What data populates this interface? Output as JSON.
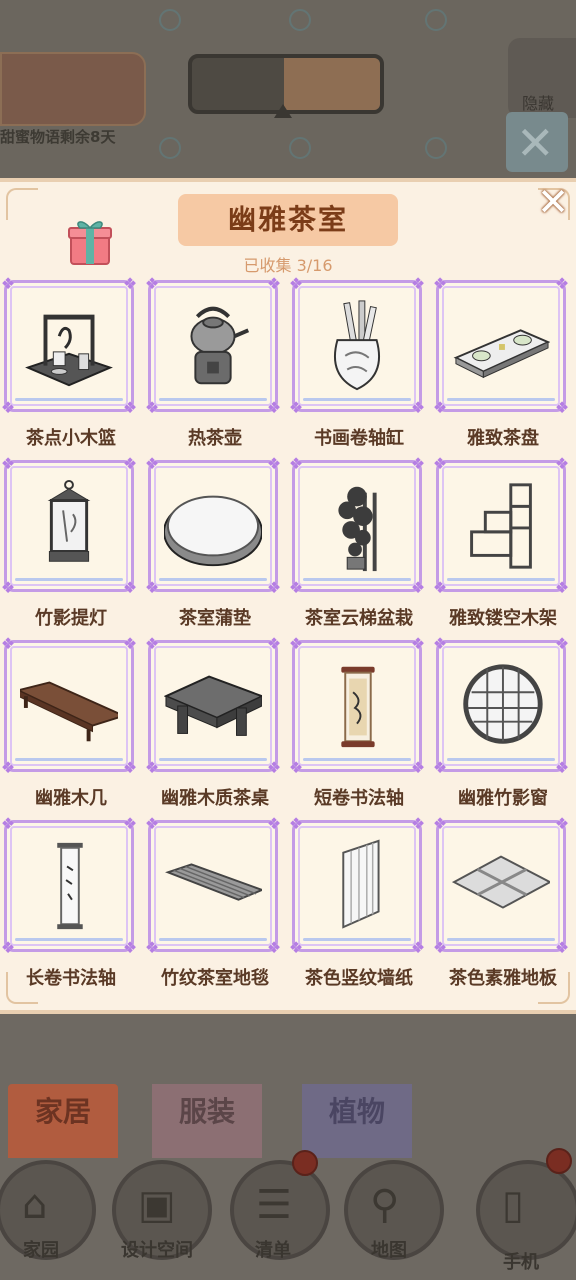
{
  "header": {
    "event_text": "甜蜜物语剩余8天",
    "hide_label": "隐藏"
  },
  "modal": {
    "title": "幽雅茶室",
    "collected_text": "已收集 3/16",
    "close_symbol": "✕",
    "items": [
      {
        "label": "茶点小木篮",
        "icon": "tea-snack-basket-icon"
      },
      {
        "label": "热茶壶",
        "icon": "teapot-icon"
      },
      {
        "label": "书画卷轴缸",
        "icon": "scroll-vase-icon"
      },
      {
        "label": "雅致茶盘",
        "icon": "tea-tray-icon"
      },
      {
        "label": "竹影提灯",
        "icon": "lantern-icon"
      },
      {
        "label": "茶室蒲垫",
        "icon": "cushion-icon"
      },
      {
        "label": "茶室云梯盆栽",
        "icon": "potted-plant-icon"
      },
      {
        "label": "雅致镂空木架",
        "icon": "wooden-shelf-icon"
      },
      {
        "label": "幽雅木几",
        "icon": "low-table-icon"
      },
      {
        "label": "幽雅木质茶桌",
        "icon": "tea-table-icon"
      },
      {
        "label": "短卷书法轴",
        "icon": "short-scroll-icon"
      },
      {
        "label": "幽雅竹影窗",
        "icon": "round-window-icon"
      },
      {
        "label": "长卷书法轴",
        "icon": "long-scroll-icon"
      },
      {
        "label": "竹纹茶室地毯",
        "icon": "bamboo-rug-icon"
      },
      {
        "label": "茶色竖纹墙纸",
        "icon": "wallpaper-icon"
      },
      {
        "label": "茶色素雅地板",
        "icon": "floor-icon"
      }
    ]
  },
  "tabs": [
    {
      "label": "家居"
    },
    {
      "label": "服装"
    },
    {
      "label": "植物"
    }
  ],
  "nav": [
    {
      "label": "家园",
      "icon": "home-icon"
    },
    {
      "label": "设计空间",
      "icon": "design-icon"
    },
    {
      "label": "清单",
      "icon": "list-icon"
    },
    {
      "label": "地图",
      "icon": "map-pin-icon"
    },
    {
      "label": "手机",
      "icon": "phone-icon"
    }
  ],
  "colors": {
    "card_border": "#c49be6",
    "title_bg": "#f6c9a4",
    "label_text": "#5a3a26"
  }
}
